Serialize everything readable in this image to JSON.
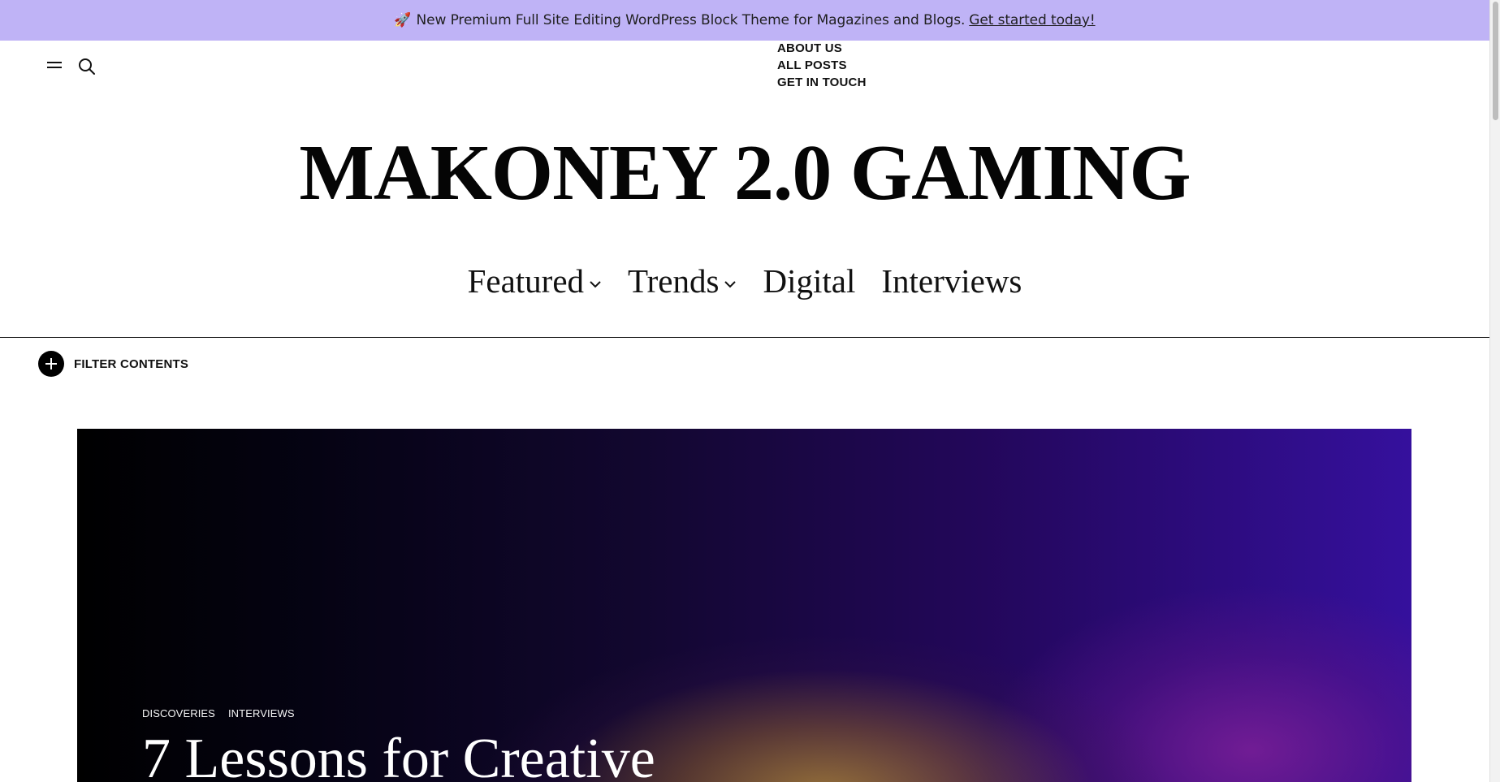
{
  "promo": {
    "emoji": "🚀",
    "text": "New Premium Full Site Editing WordPress Block Theme for Magazines and Blogs.",
    "link": "Get started today!",
    "bg_color": "#bfb3f6"
  },
  "header": {
    "menu_icon": "hamburger-icon",
    "search_icon": "search-icon",
    "utility_links": [
      "ABOUT US",
      "ALL POSTS",
      "GET IN TOUCH"
    ]
  },
  "site": {
    "title": "MAKONEY 2.0 GAMING"
  },
  "nav": {
    "items": [
      {
        "label": "Featured",
        "has_dropdown": true,
        "icon": "chevron-down-icon"
      },
      {
        "label": "Trends",
        "has_dropdown": true,
        "icon": "chevron-down-icon"
      },
      {
        "label": "Digital",
        "has_dropdown": false
      },
      {
        "label": "Interviews",
        "has_dropdown": false
      }
    ]
  },
  "filter": {
    "icon": "plus-icon",
    "label": "FILTER CONTENTS"
  },
  "hero": {
    "categories": [
      "DISCOVERIES",
      "INTERVIEWS"
    ],
    "title": "7 Lessons for Creative"
  }
}
